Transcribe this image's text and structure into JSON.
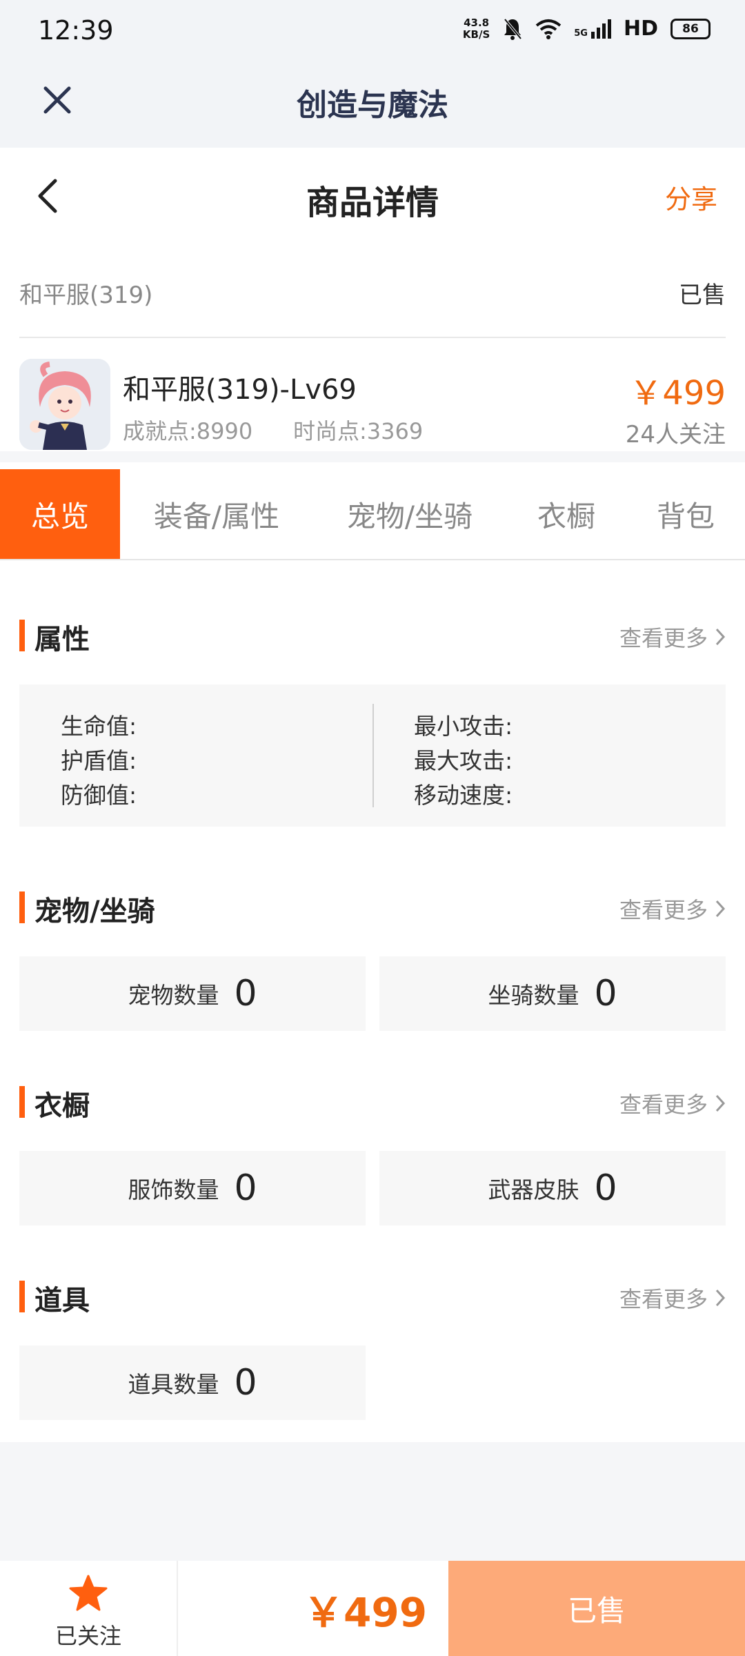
{
  "status_bar": {
    "time": "12:39",
    "net_speed_value": "43.8",
    "net_speed_unit": "KB/S",
    "network": "5G",
    "hd": "HD",
    "battery": "86"
  },
  "app_bar": {
    "title": "创造与魔法"
  },
  "detail": {
    "page_title": "商品详情",
    "share_label": "分享",
    "server_name": "和平服(319)",
    "status": "已售",
    "item": {
      "name": "和平服(319)-Lv69",
      "achievement": "成就点:8990",
      "fashion": "时尚点:3369",
      "price": "￥499",
      "followers": "24人关注"
    }
  },
  "tabs": [
    {
      "label": "总览",
      "active": true
    },
    {
      "label": "装备/属性",
      "active": false
    },
    {
      "label": "宠物/坐骑",
      "active": false
    },
    {
      "label": "衣橱",
      "active": false
    },
    {
      "label": "背包",
      "active": false
    }
  ],
  "sections": {
    "more_label": "查看更多",
    "attributes": {
      "title": "属性",
      "left": [
        "生命值:",
        "护盾值:",
        "防御值:"
      ],
      "right": [
        "最小攻击:",
        "最大攻击:",
        "移动速度:"
      ]
    },
    "pets": {
      "title": "宠物/坐骑",
      "cards": [
        {
          "label": "宠物数量",
          "value": "0"
        },
        {
          "label": "坐骑数量",
          "value": "0"
        }
      ]
    },
    "wardrobe": {
      "title": "衣橱",
      "cards": [
        {
          "label": "服饰数量",
          "value": "0"
        },
        {
          "label": "武器皮肤",
          "value": "0"
        }
      ]
    },
    "items": {
      "title": "道具",
      "cards": [
        {
          "label": "道具数量",
          "value": "0"
        }
      ]
    }
  },
  "bottom_bar": {
    "follow_label": "已关注",
    "price": "￥499",
    "buy_label": "已售"
  },
  "colors": {
    "accent": "#ff5f0f",
    "price": "#f06a10",
    "sold_button": "#fdaa79",
    "app_bar_bg": "#f2f4f7"
  },
  "icons": [
    "close-icon",
    "back-icon",
    "chevron-right-icon",
    "star-icon",
    "wifi-icon",
    "signal-icon",
    "battery-icon",
    "mute-bell-icon"
  ]
}
